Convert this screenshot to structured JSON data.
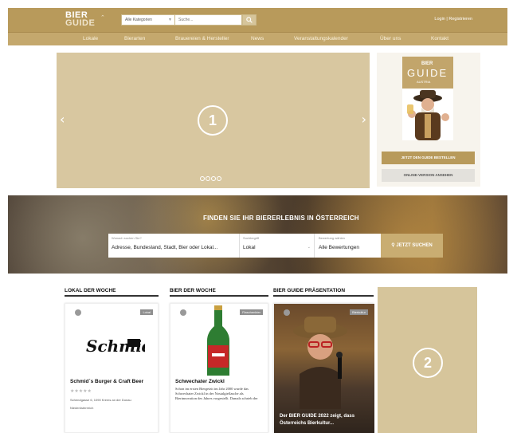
{
  "header": {
    "logo_line1": "BIER",
    "logo_line2": "GUIDE",
    "category_select": "Alle Kategorien",
    "search_placeholder": "Suche...",
    "login": "Login | Registrieren"
  },
  "nav": {
    "items": [
      "Lokale",
      "Bierarten",
      "Brauereien & Hersteller",
      "News",
      "Veranstaltungskalender",
      "Über uns",
      "Kontakt"
    ]
  },
  "slider": {
    "marker": "1",
    "prev": "‹",
    "next": "›",
    "dots": 4,
    "active_dot": 0
  },
  "promo": {
    "book_line1": "BIER",
    "book_line2": "GUIDE",
    "book_line3": "AUSTRIA",
    "order_label": "JETZT DEN GUIDE BESTELLEN",
    "online_label": "ONLINE-VERSION ANSEHEN"
  },
  "hero": {
    "title": "FINDEN SIE IHR BIERERLEBNIS IN ÖSTERREICH",
    "location_label": "Wonach suchen Sie?",
    "location_value": "Adresse, Bundesland, Stadt, Bier oder Lokal...",
    "type_label": "Suchbegriff",
    "type_value": "Lokal",
    "rating_label": "Bewertung wählen",
    "rating_value": "Alle Bewertungen",
    "search_button": "JETZT SUCHEN"
  },
  "columns": {
    "lokal_title": "LOKAL DER WOCHE",
    "bier_title": "BIER DER WOCHE",
    "pres_title": "BIER GUIDE PRÄSENTATION"
  },
  "lokal_card": {
    "badge": "Lokal",
    "logo_text": "Schmid's",
    "name": "Schmid´s Burger & Craft Beer",
    "stars": "★★★★★",
    "address": "Schendgasse 6, 1090 Krems an der Donau",
    "region": "Niederösterreich"
  },
  "bier_card": {
    "badge": "Flaschenbier",
    "name": "Schwechater Zwickl",
    "description": "Schon im ersten Biergeizit im Jahr 2000 wurde das Schwechater Zwickl in der Nostalgieflasche als Bierinnovation des Jahres vorgestellt. Damals schrieb der"
  },
  "pres_card": {
    "badge": "Bierkultur",
    "text": "Der BIER GUIDE 2022 zeigt, dass Österreichs Bierkultur..."
  },
  "side": {
    "marker": "2"
  },
  "colors": {
    "brand_gold": "#b89a5b",
    "nav_gold": "#c4a86d",
    "placeholder_beige": "#d8c7a0"
  }
}
